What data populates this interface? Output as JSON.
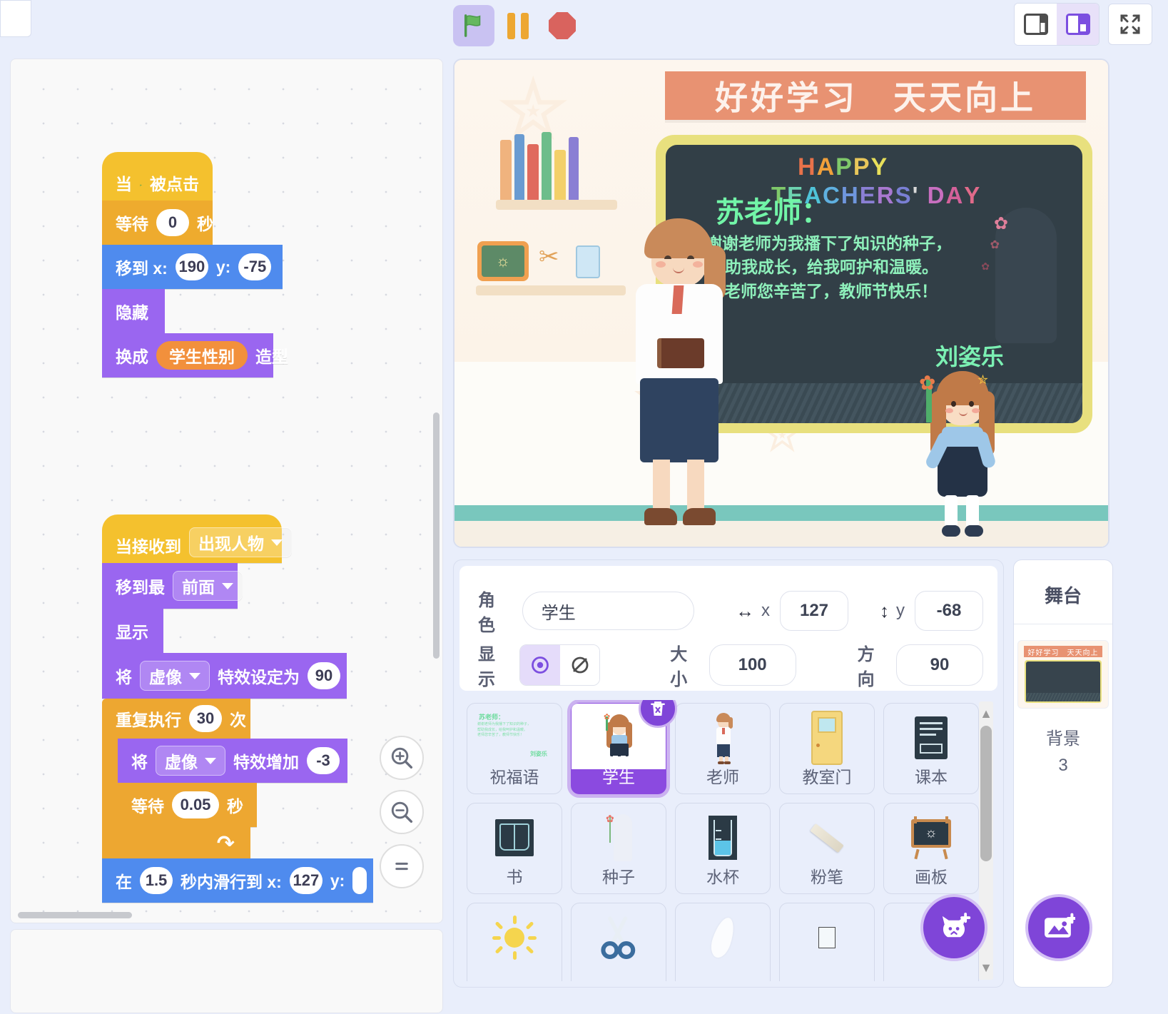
{
  "toolbar": {
    "green_flag": "green-flag",
    "pause": "pause",
    "stop": "stop",
    "layout_small": "small-stage-layout",
    "layout_large": "large-stage-layout",
    "fullscreen": "fullscreen"
  },
  "code": {
    "scripts": [
      {
        "blocks": [
          {
            "type": "hat",
            "cat": "event",
            "parts": [
              "当",
              "flag-icon",
              "被点击"
            ]
          },
          {
            "type": "stack",
            "cat": "event",
            "parts": [
              "等待",
              "0",
              "秒"
            ]
          },
          {
            "type": "stack",
            "cat": "motion",
            "parts": [
              "移到 x:",
              "190",
              "y:",
              "-75"
            ]
          },
          {
            "type": "stack",
            "cat": "looks",
            "parts": [
              "隐藏"
            ]
          },
          {
            "type": "stack",
            "cat": "looks",
            "parts": [
              "换成",
              "学生性别",
              "造型"
            ]
          }
        ]
      },
      {
        "blocks": [
          {
            "type": "hat",
            "cat": "event",
            "parts": [
              "当接收到",
              "出现人物"
            ]
          },
          {
            "type": "stack",
            "cat": "looks",
            "parts": [
              "移到最",
              "前面"
            ]
          },
          {
            "type": "stack",
            "cat": "looks",
            "parts": [
              "显示"
            ]
          },
          {
            "type": "stack",
            "cat": "looks",
            "parts": [
              "将",
              "虚像",
              "特效设定为",
              "90"
            ]
          },
          {
            "type": "c",
            "cat": "control",
            "parts": [
              "重复执行",
              "30",
              "次"
            ]
          },
          {
            "type": "stack",
            "cat": "looks",
            "parts": [
              "将",
              "虚像",
              "特效增加",
              "-3"
            ]
          },
          {
            "type": "stack",
            "cat": "control",
            "parts": [
              "等待",
              "0.05",
              "秒"
            ]
          },
          {
            "type": "stack",
            "cat": "motion",
            "parts": [
              "在",
              "1.5",
              "秒内滑行到 x:",
              "127",
              "y:"
            ]
          }
        ]
      }
    ],
    "labels": {
      "when": "当",
      "clicked": "被点击",
      "wait": "等待",
      "sec": "秒",
      "goto_x": "移到 x:",
      "y": "y:",
      "hide": "隐藏",
      "switch_costume_pre": "换成",
      "switch_costume_post": "造型",
      "costume_var": "学生性别",
      "wait_val": "0",
      "goto_x_val": "190",
      "goto_y_val": "-75",
      "when_receive": "当接收到",
      "message": "出现人物",
      "go_to_layer_pre": "移到最",
      "layer_front": "前面",
      "show": "显示",
      "set_pre": "将",
      "ghost": "虚像",
      "set_effect_to": "特效设定为",
      "set_effect_val": "90",
      "repeat": "重复执行",
      "repeat_val": "30",
      "times": "次",
      "change_effect_by": "特效增加",
      "change_effect_val": "-3",
      "wait2_val": "0.05",
      "glide_pre": "在",
      "glide_secs": "1.5",
      "glide_mid": "秒内滑行到 x:",
      "glide_x": "127",
      "glide_y_label": "y:"
    },
    "zoom_in": "zoom-in",
    "zoom_out": "zoom-out",
    "zoom_reset": "zoom-reset"
  },
  "stage": {
    "banner": "好好学习　天天向上",
    "board_title_happy": "HAPPY",
    "board_title_teachers": "TEACHERS'",
    "board_title_day": "DAY",
    "greeting": "苏老师：",
    "body_line1": "谢谢老师为我播下了知识的种子，",
    "body_line2": "帮助我成长，给我呵护和温暖。",
    "body_line3": "老师您辛苦了，教师节快乐！",
    "signature": "刘姿乐"
  },
  "sprite_info": {
    "name_label": "角色",
    "name_value": "学生",
    "x_label": "x",
    "x_value": "127",
    "y_label": "y",
    "y_value": "-68",
    "show_label": "显示",
    "size_label": "大小",
    "size_value": "100",
    "direction_label": "方向",
    "direction_value": "90"
  },
  "sprites": [
    {
      "label": "祝福语",
      "icon": "greeting-card",
      "selected": false
    },
    {
      "label": "学生",
      "icon": "student-girl",
      "selected": true
    },
    {
      "label": "老师",
      "icon": "teacher-woman",
      "selected": false
    },
    {
      "label": "教室门",
      "icon": "classroom-door",
      "selected": false
    },
    {
      "label": "课本",
      "icon": "textbook",
      "selected": false
    },
    {
      "label": "书",
      "icon": "open-book",
      "selected": false
    },
    {
      "label": "种子",
      "icon": "seed-flower",
      "selected": false
    },
    {
      "label": "水杯",
      "icon": "water-cup",
      "selected": false
    },
    {
      "label": "粉笔",
      "icon": "chalk",
      "selected": false
    },
    {
      "label": "画板",
      "icon": "drawing-board",
      "selected": false
    },
    {
      "label": "",
      "icon": "sun",
      "selected": false
    },
    {
      "label": "",
      "icon": "scissors",
      "selected": false
    },
    {
      "label": "",
      "icon": "feather",
      "selected": false
    },
    {
      "label": "",
      "icon": "white-square",
      "selected": false
    },
    {
      "label": "",
      "icon": "blank",
      "selected": false
    }
  ],
  "stage_panel": {
    "title": "舞台",
    "thumb_banner": "好好学习　天天向上",
    "caption_label": "背景",
    "caption_count": "3"
  },
  "buttons": {
    "add_sprite": "add-sprite",
    "add_backdrop": "add-backdrop",
    "delete_sprite": "delete-sprite"
  },
  "colors": {
    "accent": "#7f45d8",
    "event": "#f4c12e",
    "event2": "#eeab2e",
    "motion": "#4f8bee",
    "looks": "#9a66f0",
    "control": "#eda731",
    "banner": "#e89272",
    "board": "#323f47"
  }
}
